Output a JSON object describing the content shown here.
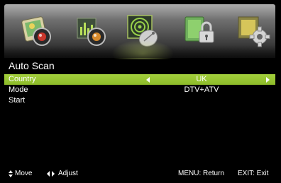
{
  "menu": {
    "tabs": [
      {
        "icon": "picture-icon",
        "active": false
      },
      {
        "icon": "sound-icon",
        "active": false
      },
      {
        "icon": "channel-icon",
        "active": true
      },
      {
        "icon": "lock-icon",
        "active": false
      },
      {
        "icon": "setup-icon",
        "active": false
      }
    ]
  },
  "page": {
    "title": "Auto Scan"
  },
  "settings": [
    {
      "label": "Country",
      "value": "UK",
      "selected": true
    },
    {
      "label": "Mode",
      "value": "DTV+ATV",
      "selected": false
    },
    {
      "label": "Start",
      "value": "",
      "selected": false
    }
  ],
  "footer": {
    "move": "Move",
    "adjust": "Adjust",
    "menu_return": "MENU: Return",
    "exit": "EXIT: Exit"
  },
  "colors": {
    "selected_row": "#9ec834",
    "background": "#000000"
  }
}
